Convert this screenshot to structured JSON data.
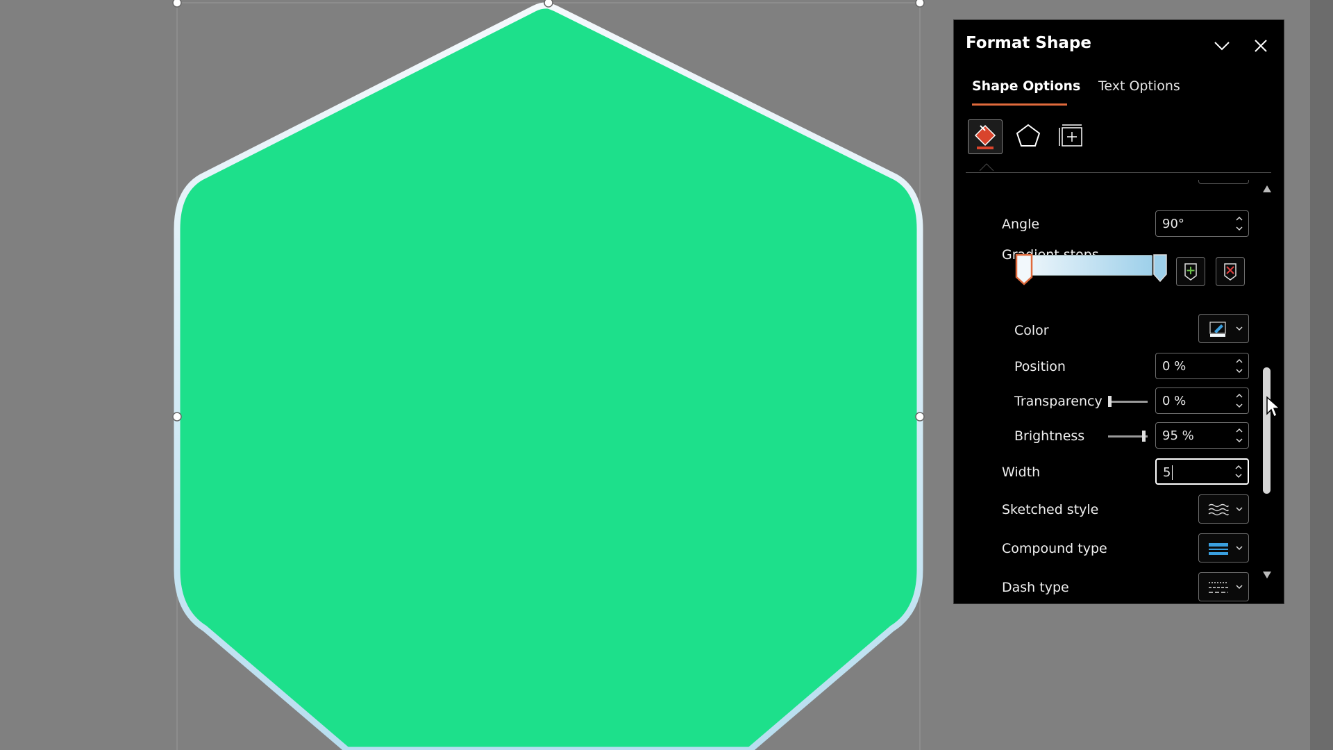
{
  "panel": {
    "title": "Format Shape",
    "tabs": [
      {
        "label": "Shape Options",
        "active": true
      },
      {
        "label": "Text Options",
        "active": false
      }
    ],
    "categories": [
      "fill-and-line",
      "effects",
      "size-and-properties"
    ],
    "rows": {
      "angle": {
        "label": "Angle",
        "value": "90°"
      },
      "gradient_stops": {
        "label": "Gradient stops",
        "start_color": "#f2f8fc",
        "end_color": "#9ed0ea"
      },
      "color": {
        "label": "Color"
      },
      "position": {
        "label": "Position",
        "value": "0 %"
      },
      "transparency": {
        "label": "Transparency",
        "value": "0 %",
        "slider": 0
      },
      "brightness": {
        "label": "Brightness",
        "value": "95 %",
        "slider": 0.95
      },
      "width": {
        "label": "Width",
        "value": "5"
      },
      "sketched_style": {
        "label": "Sketched style"
      },
      "compound_type": {
        "label": "Compound type"
      },
      "dash_type": {
        "label": "Dash type"
      }
    }
  },
  "shape": {
    "fill_color": "#1de08b",
    "outline_color": "#d9eef8"
  },
  "colors": {
    "accent_tab": "#e06a3c",
    "canvas_bg": "#808080",
    "panel_bg": "#000000"
  }
}
